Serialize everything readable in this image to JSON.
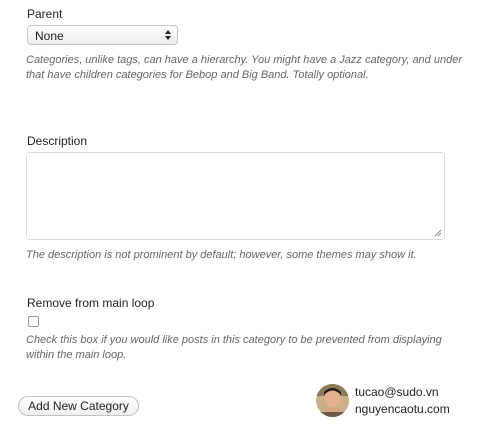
{
  "parent": {
    "label": "Parent",
    "selected": "None",
    "help": "Categories, unlike tags, can have a hierarchy. You might have a Jazz category, and under that have children categories for Bebop and Big Band. Totally optional."
  },
  "description": {
    "label": "Description",
    "value": "",
    "help": "The description is not prominent by default; however, some themes may show it."
  },
  "main_loop": {
    "label": "Remove from main loop",
    "help": "Check this box if you would like posts in this category to be prevented from displaying within the main loop."
  },
  "submit": {
    "label": "Add New Category"
  },
  "credit": {
    "email": "tucao@sudo.vn",
    "site": "nguyencaotu.com"
  },
  "colors": {
    "help_text": "#666666",
    "border": "#c9c9c9"
  }
}
